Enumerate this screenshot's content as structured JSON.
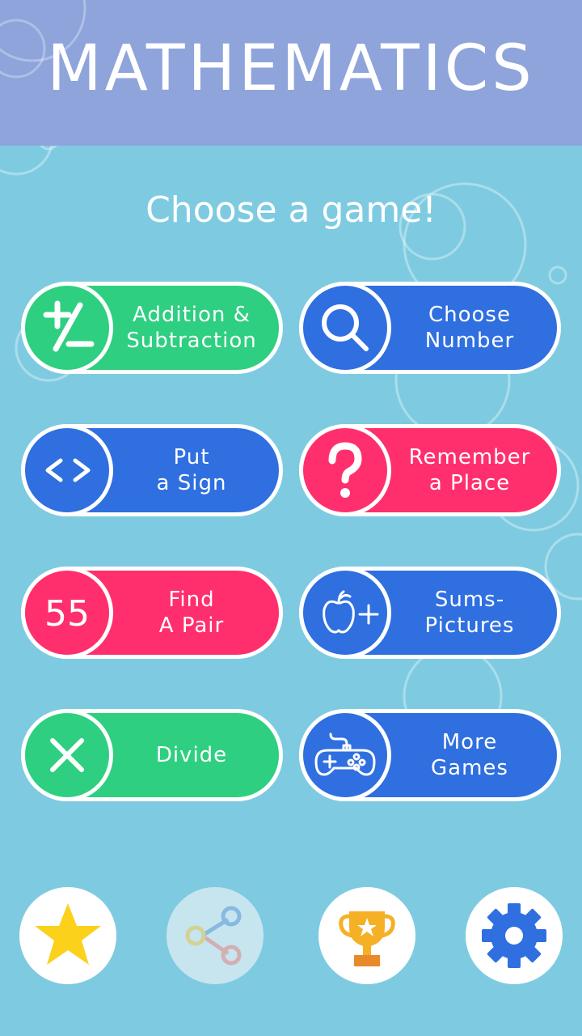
{
  "header": {
    "title": "MATHEMATICS"
  },
  "subtitle": "Choose a game!",
  "games": [
    {
      "label": "Addition &\nSubtraction",
      "icon": "plus-minus-icon",
      "color": "#2ecf80"
    },
    {
      "label": "Choose\nNumber",
      "icon": "magnifier-icon",
      "color": "#2f6fe0"
    },
    {
      "label": "Put\na Sign",
      "icon": "angle-brackets-icon",
      "color": "#2f6fe0"
    },
    {
      "label": "Remember\na Place",
      "icon": "question-mark-icon",
      "color": "#ff2f6d"
    },
    {
      "label": "Find\nA Pair",
      "icon": "number-55-icon",
      "icon_text": "55",
      "color": "#ff2f6d"
    },
    {
      "label": "Sums-\nPictures",
      "icon": "apple-plus-icon",
      "color": "#2f6fe0"
    },
    {
      "label": "Divide",
      "icon": "x-mark-icon",
      "color": "#2ecf80"
    },
    {
      "label": "More\nGames",
      "icon": "gamepad-icon",
      "color": "#2f6fe0"
    }
  ],
  "bottom_bar": [
    {
      "icon": "star-icon",
      "color": "#fbd11b"
    },
    {
      "icon": "share-icon",
      "state": "faded"
    },
    {
      "icon": "trophy-icon",
      "color": "#f5b026"
    },
    {
      "icon": "gear-icon",
      "color": "#2f6fe0"
    }
  ],
  "colors": {
    "background": "#7ecbe1",
    "header": "#8ea4db",
    "green": "#2ecf80",
    "blue": "#2f6fe0",
    "pink": "#ff2f6d"
  }
}
